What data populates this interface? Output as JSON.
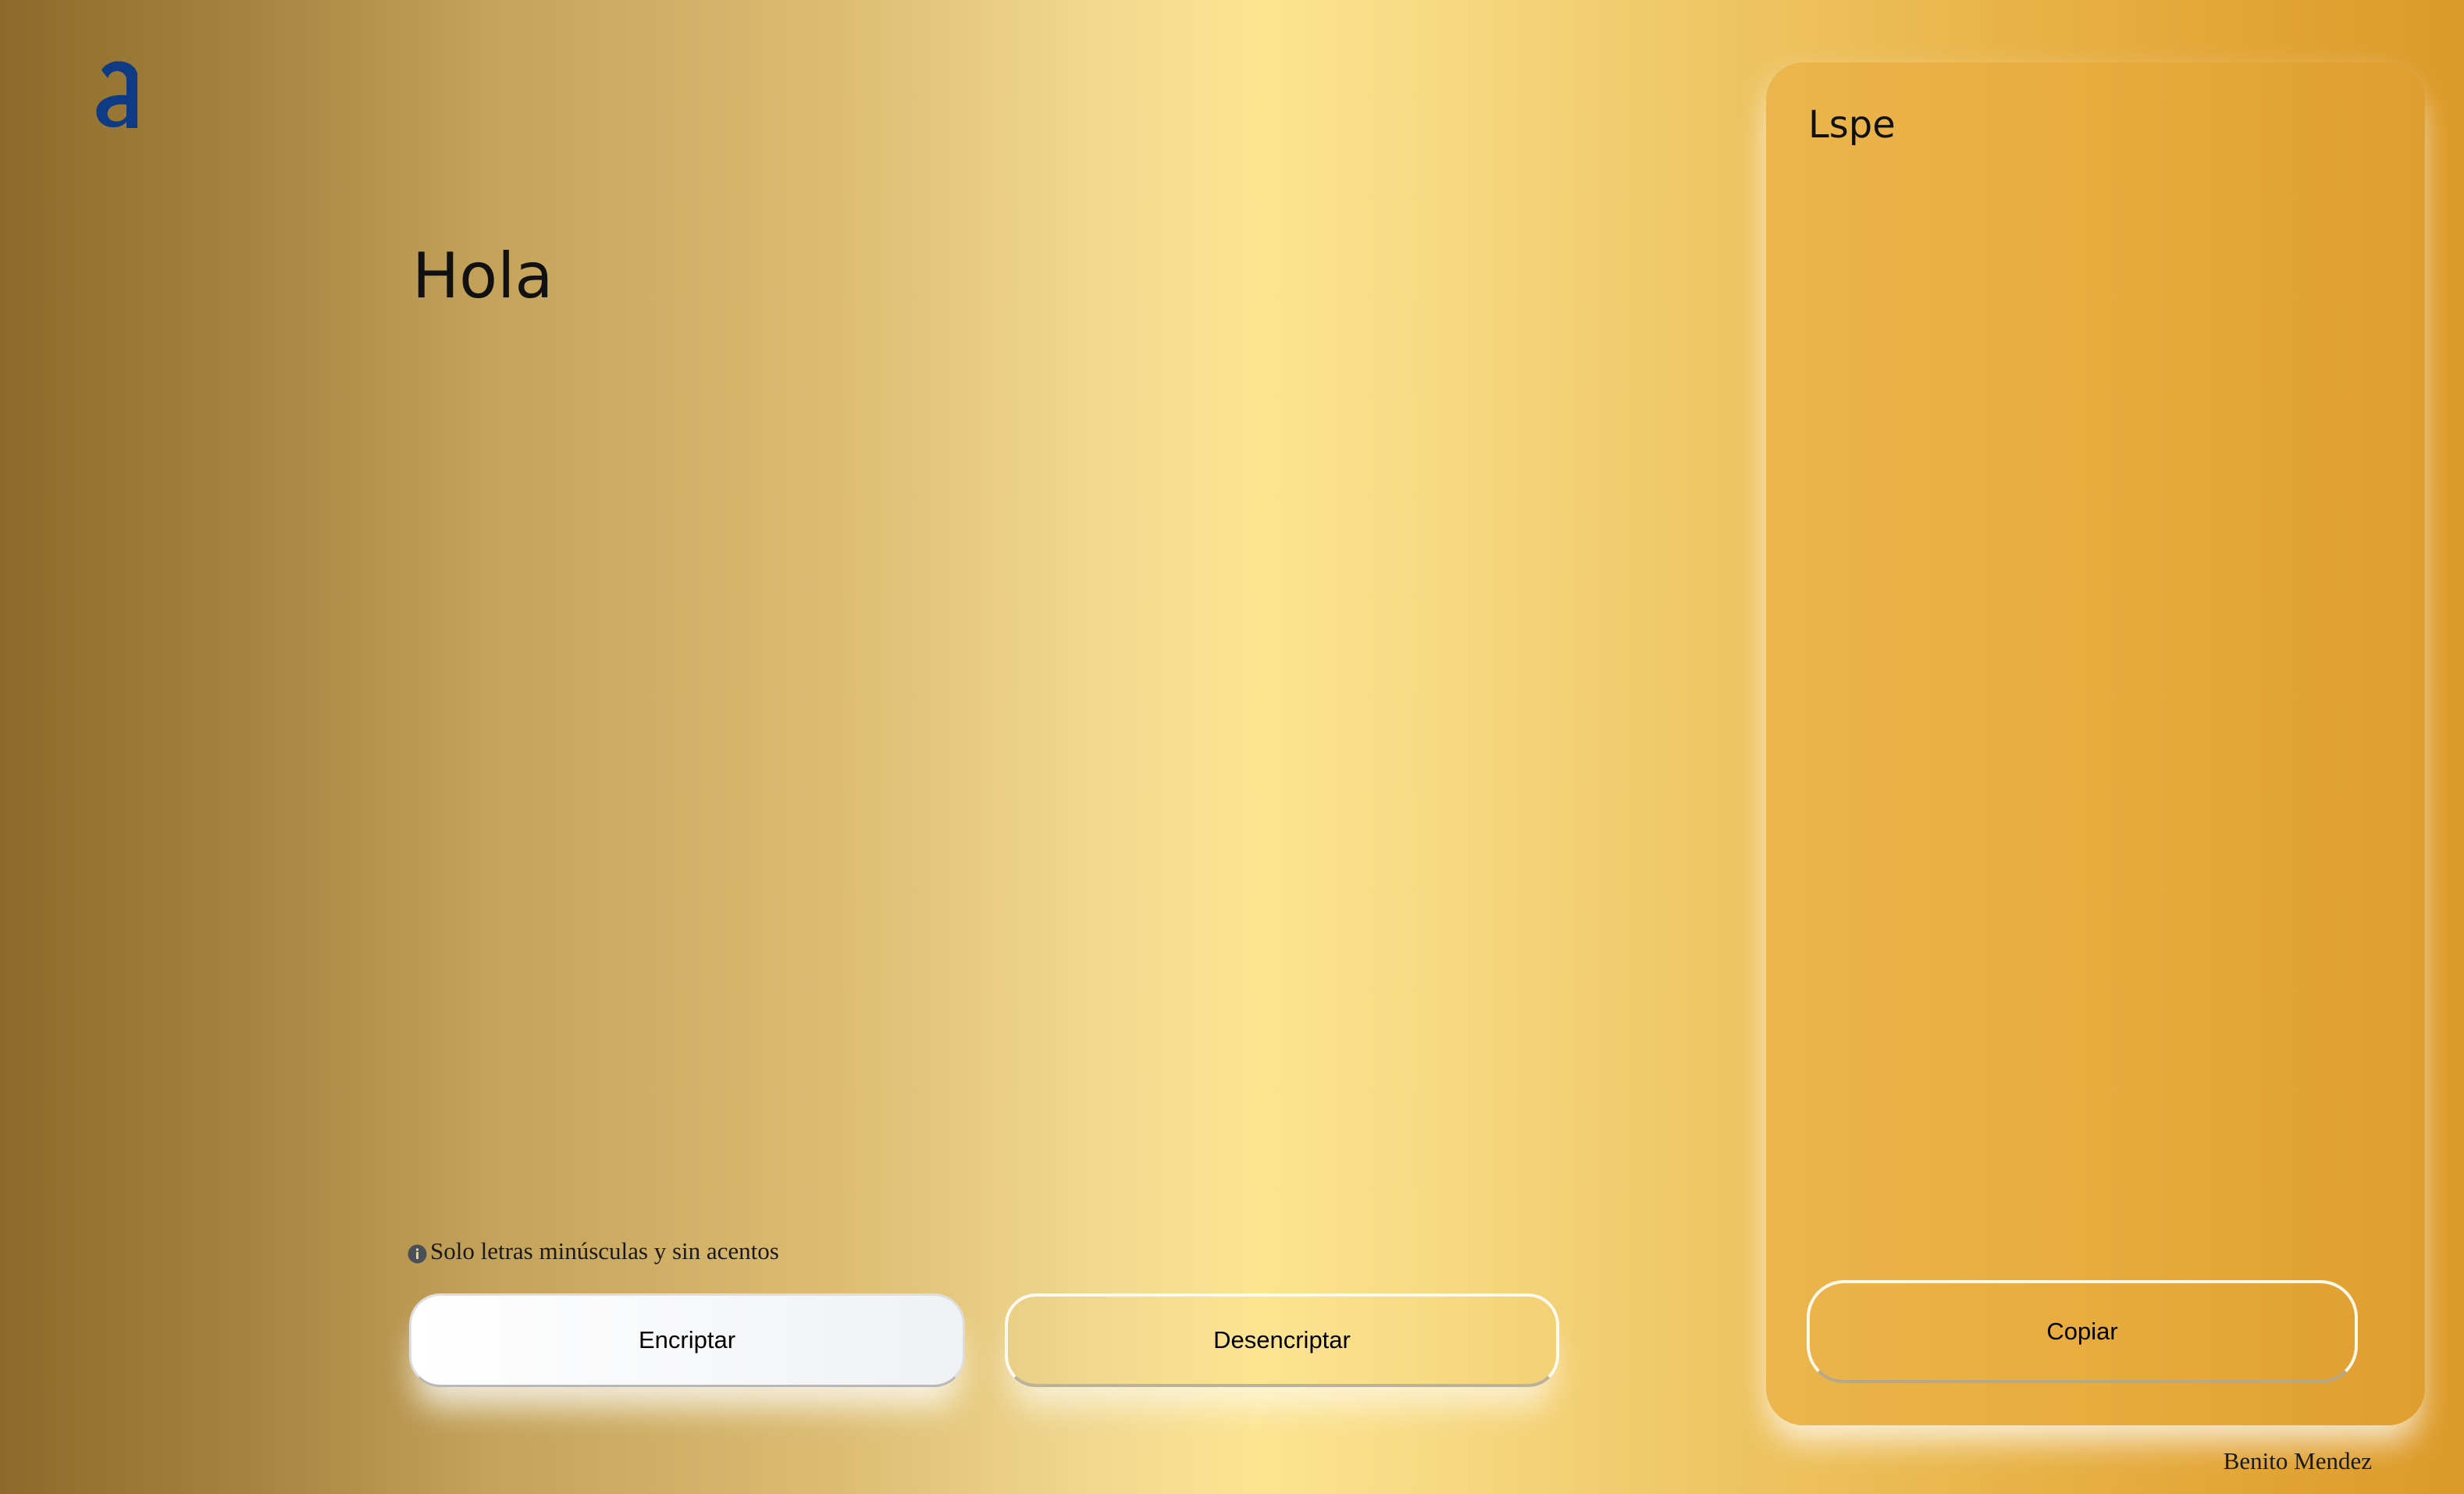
{
  "input": {
    "text": "Hola"
  },
  "hint": {
    "text": "Solo letras minúsculas y sin acentos",
    "icon": "info-icon"
  },
  "buttons": {
    "encrypt_label": "Encriptar",
    "decrypt_label": "Desencriptar",
    "copy_label": "Copiar"
  },
  "output": {
    "text": "Lspe"
  },
  "footer": {
    "author": "Benito Mendez"
  },
  "colors": {
    "logo": "#0f3b85",
    "background_left": "#8c6b2a",
    "background_center": "#fce491",
    "background_right": "#dc9a28",
    "panel": "#e7aa3d"
  }
}
